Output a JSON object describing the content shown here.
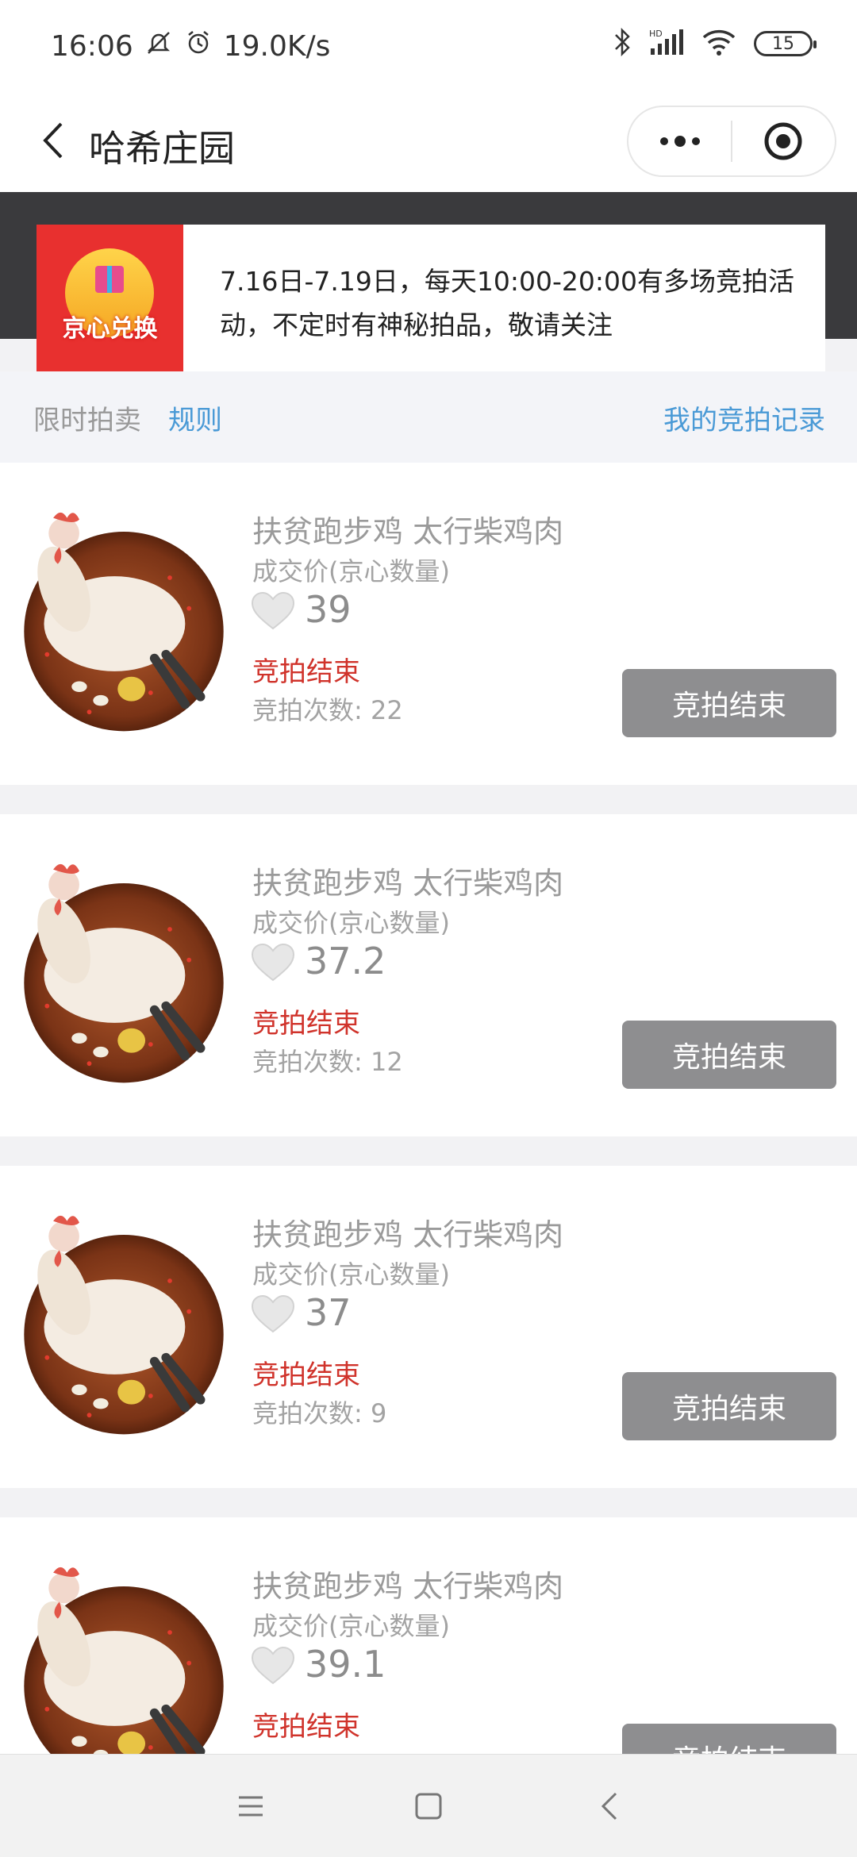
{
  "status_bar": {
    "time": "16:06",
    "network_speed": "19.0K/s",
    "battery_level": "15",
    "icons": [
      "mute-icon",
      "alarm-icon",
      "bluetooth-icon",
      "hd-signal-icon",
      "wifi-icon",
      "battery-icon"
    ]
  },
  "nav": {
    "title": "哈希庄园",
    "back_icon": "chevron-left-icon",
    "more_icon": "more-dots-icon",
    "close_icon": "target-close-icon"
  },
  "notice": {
    "logo_text": "京心兑换",
    "text": "7.16日-7.19日，每天10:00-20:00有多场竞拍活动，不定时有神秘拍品，敬请关注"
  },
  "section": {
    "tab_flash": "限时拍卖",
    "tab_rules": "规则",
    "my_records": "我的竞拍记录"
  },
  "items": [
    {
      "name": "扶贫跑步鸡 太行柴鸡肉",
      "price_label": "成交价(京心数量)",
      "price": "39",
      "status": "竞拍结束",
      "count": "竞拍次数: 22",
      "button": "竞拍结束"
    },
    {
      "name": "扶贫跑步鸡 太行柴鸡肉",
      "price_label": "成交价(京心数量)",
      "price": "37.2",
      "status": "竞拍结束",
      "count": "竞拍次数: 12",
      "button": "竞拍结束"
    },
    {
      "name": "扶贫跑步鸡 太行柴鸡肉",
      "price_label": "成交价(京心数量)",
      "price": "37",
      "status": "竞拍结束",
      "count": "竞拍次数: 9",
      "button": "竞拍结束"
    },
    {
      "name": "扶贫跑步鸡 太行柴鸡肉",
      "price_label": "成交价(京心数量)",
      "price": "39.1",
      "status": "竞拍结束",
      "count": "",
      "button": "竞拍结束"
    }
  ],
  "colors": {
    "accent_blue": "#4a9ad6",
    "status_red": "#d0332b",
    "button_gray": "#8e8e90",
    "header_dark": "#3a3a3d",
    "logo_red": "#e8302f"
  },
  "system_nav": {
    "icons": [
      "menu-icon",
      "home-square-icon",
      "back-triangle-icon"
    ]
  }
}
